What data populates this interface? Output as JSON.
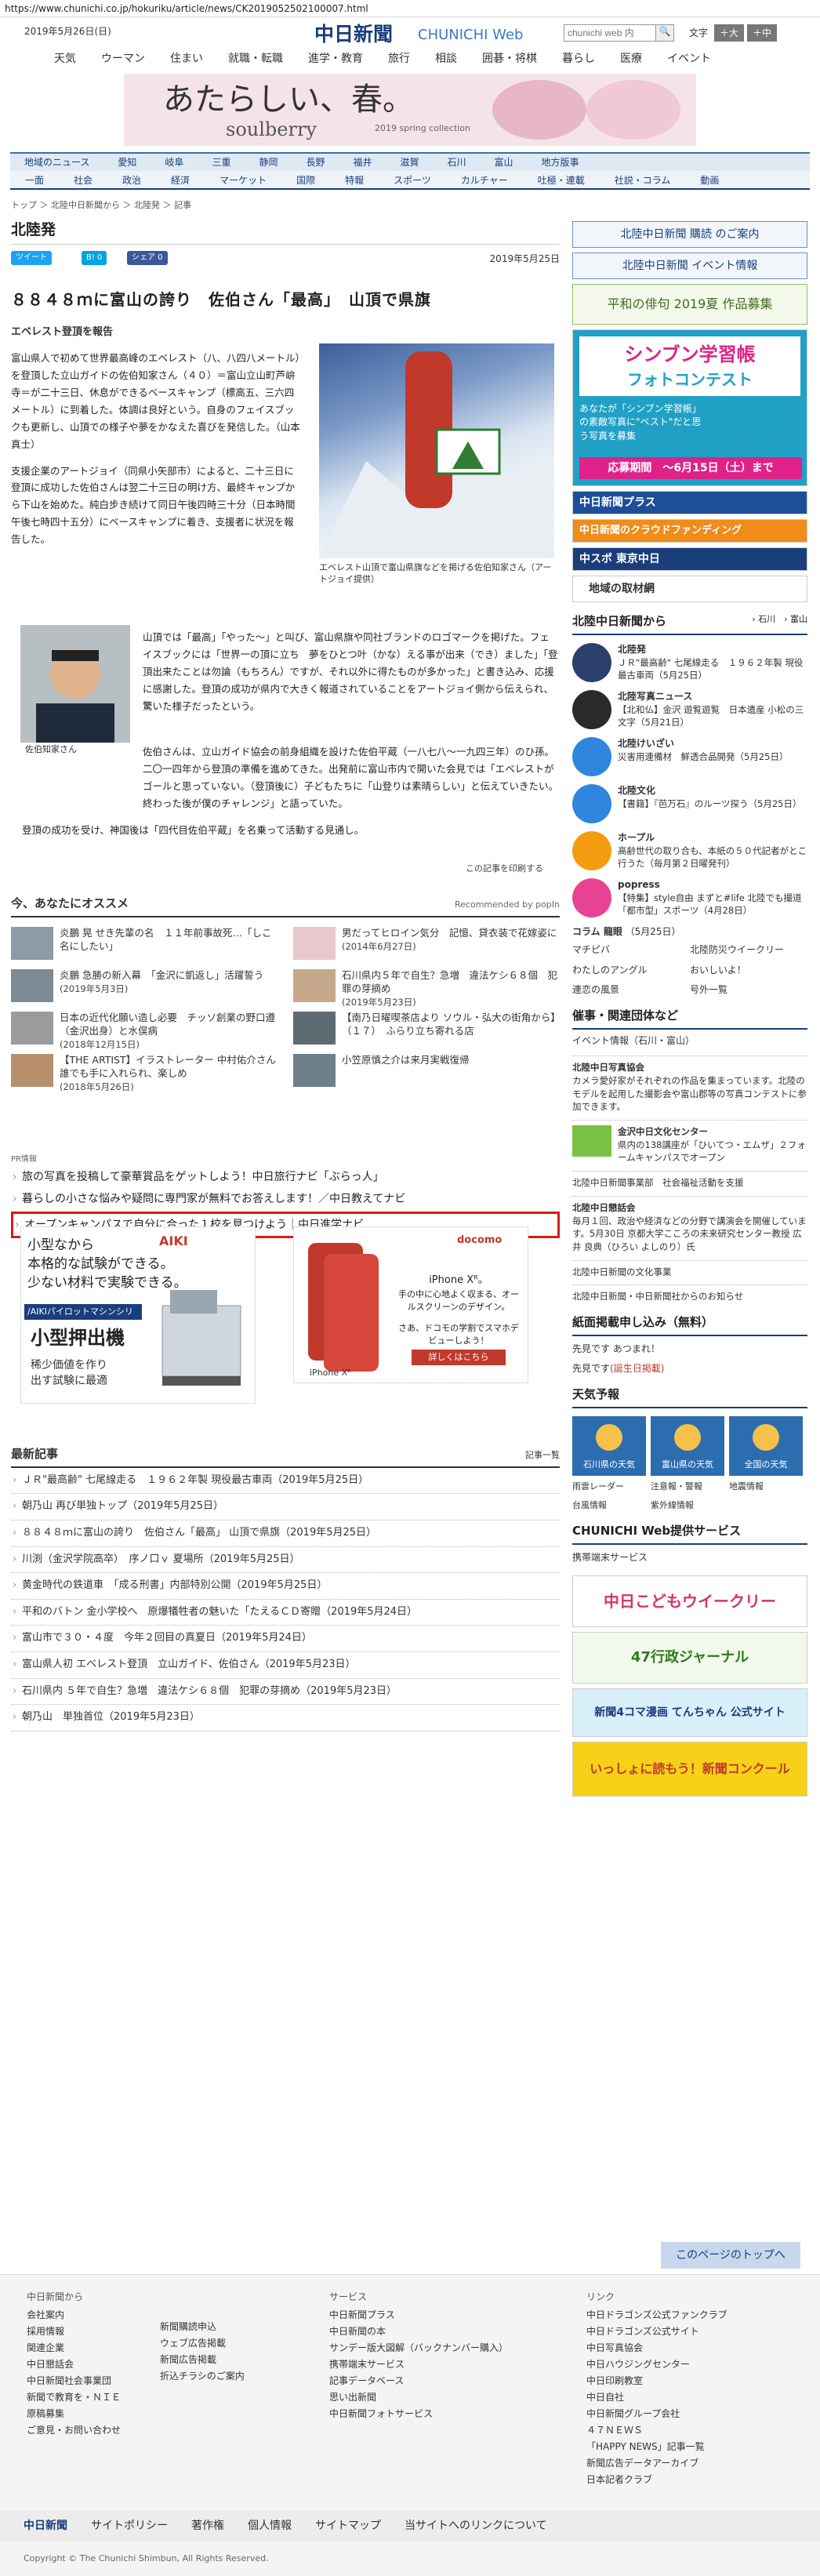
{
  "url": "https://www.chunichi.co.jp/hokuriku/article/news/CK2019052502100007.html",
  "header": {
    "date": "2019年5月26日(日)",
    "logo": "中日新聞",
    "logo_sub": "CHUNICHI Web",
    "search_placeholder": "chunichi web 内",
    "search_button": "🔍",
    "font_label": "文字",
    "font_large": "＋大",
    "font_medium": "＋中"
  },
  "top_nav": [
    "天気",
    "ウーマン",
    "住まい",
    "就職・転職",
    "進学・教育",
    "旅行",
    "相談",
    "囲碁・将棋",
    "暮らし",
    "医療",
    "イベント"
  ],
  "ad_banner": {
    "headline": "あたらしい、春。",
    "brand": "soulberry",
    "sub": "2019 spring collection"
  },
  "region_nav": [
    "地域のニュース",
    "愛知",
    "岐阜",
    "三重",
    "静岡",
    "長野",
    "福井",
    "滋賀",
    "石川",
    "富山",
    "地方版事"
  ],
  "category_nav": [
    "一面",
    "社会",
    "政治",
    "経済",
    "マーケット",
    "国際",
    "特報",
    "スポーツ",
    "カルチャー",
    "吐極・連載",
    "社説・コラム",
    "動画"
  ],
  "breadcrumb": "トップ ＞ 北陸中日新聞から ＞ 北陸発 ＞ 記事",
  "section": "北陸発",
  "share": {
    "tweet": "ツイート",
    "hatena": "B! 0",
    "facebook": "シェア 0"
  },
  "article": {
    "date": "2019年5月25日",
    "title": "８８４８ｍに富山の誇り　佐伯さん「最高」　山頂で県旗",
    "subhead": "エベレスト登頂を報告",
    "p1": "富山県人で初めて世界最高峰のエベレスト（八、八四八メートル）を登頂した立山ガイドの佐伯知家さん（４０）＝富山立山町芦峅寺＝が二十三日、休息ができるベースキャンプ（標高五、三六四メートル）に到着した。体調は良好という。自身のフェイスブックも更新し、山頂での様子や夢をかなえた喜びを発信した。（山本真士）",
    "p2": "支援企業のアートジョイ（同県小矢部市）によると、二十三日に登頂に成功した佐伯さんは翌二十三日の明け方、最終キャンプから下山を始めた。純白步き続けて同日午後四時三十分（日本時間午後七時四十五分）にベースキャンプに着き、支援者に状況を報告した。",
    "p3": "山頂では「最高」「やった～」と叫び、富山県旗や同社ブランドのロゴマークを掲げた。フェイスブックには「世界一の頂に立ち　夢をひとつ叶（かな）える事が出来（でき）ました」「登頂出来たことは勿論（もちろん）ですが、それ以外に得たものが多かった」と書き込み、応援に感謝した。登頂の成功が県内で大きく報道されていることをアートジョイ側から伝えられ、驚いた様子だったという。",
    "p4": "佐伯さんは、立山ガイド協会の前身組織を設けた佐伯平蔵（一八七八～一九四三年）のひ孫。二〇一四年から登頂の準備を進めてきた。出発前に富山市内で開いた会見では「エベレストがゴールと思っていない。（登頂後に）子どもたちに「山登りは素晴らしい」と伝えていきたい。終わった後が僕のチャレンジ」と語っていた。",
    "p5": "登頂の成功を受け、神国後は「四代目佐伯平蔵」を名乗って活動する見通し。",
    "photo_caption": "エベレスト山頂で富山県旗などを掲げる佐伯知家さん（アートジョイ提供）",
    "portrait_caption": "佐伯知家さん",
    "print": "この記事を印刷する"
  },
  "recommend": {
    "heading": "今、あなたにオススメ",
    "powered": "Recommended by popIn",
    "items": [
      {
        "text": "炎鵬 晃 せき先輩の名　１１年前事故死…「しこ名にしたい」",
        "date": ""
      },
      {
        "text": "男だってヒロイン気分　記憶、貸衣装で花嫁姿に",
        "date": "(2014年6月27日)"
      },
      {
        "text": "炎鵬 急勝の新入幕　「金沢に凱返し」活躍誓う",
        "date": "(2019年5月3日)"
      },
      {
        "text": "石川県内５年で自生？急増　違法ケシ６８個　犯罪の芽摘め",
        "date": "(2019年5月23日)"
      },
      {
        "text": "日本の近代化願い造し必要　チッソ創業の野口遵（金沢出身）と水俣病",
        "date": "(2018年12月15日)"
      },
      {
        "text": "【南乃日曜喫茶店より ソウル・弘大の街角から】（１７）　ふらり立ち寄れる店",
        "date": ""
      },
      {
        "text": "【THE ARTIST】イラストレーター 中村佑介さん　誰でも手に入れられ、楽しめ",
        "date": "(2018年5月26日)"
      },
      {
        "text": "小笠原慎之介は来月実戦復帰",
        "date": ""
      }
    ]
  },
  "pr": {
    "label": "PR情報",
    "items": [
      "旅の写真を投稿して豪華賞品をゲットしよう！中日旅行ナビ「ぶらっ人」",
      "暮らしの小さな悩みや疑問に専門家が無料でお答えします！／中日教えてナビ",
      "オープンキャンパスで自分に合った１校を見つけよう｜中日進学ナビ"
    ]
  },
  "ads": {
    "aiki_l1": "小型なから",
    "aiki_l2": "本格的な試験ができる。",
    "aiki_l3": "少ない材料で実験できる。",
    "aiki_brand": "AIKI",
    "aiki_series": "/AIKIパイロットマシンシリーズ",
    "aiki_product": "小型押出機",
    "aiki_note": "稀少価値を作り出す試験に最適",
    "docomo_brand": "docomo",
    "docomo_l1": "iPhone Xᴿ。",
    "docomo_l2": "手の中に心地よく収まる、オールスクリーンのデザイン。",
    "docomo_l3": "さあ、ドコモの学割でスマホデビューしよう！",
    "docomo_btn": "詳しくはこちら",
    "docomo_product": "iPhone Xᴿ"
  },
  "latest": {
    "heading": "最新記事",
    "more": "記事一覧",
    "items": [
      "ＪＲ\"最高齢\" 七尾線走る　１９６２年製 現役最古車両（2019年5月25日）",
      "朝乃山 再び単独トップ（2019年5月25日）",
      "８８４８ｍに富山の誇り　佐伯さん「最高」 山頂で県旗（2019年5月25日）",
      "川渕（金沢学院高卒）　序ノ口ｖ 夏場所（2019年5月25日）",
      "黄金時代の鉄道車　「成る刑書」内部特別公開（2019年5月25日）",
      "平和のバトン 金小学校へ　原爆犠牲者の魅いた「たえるＣＤ寄贈（2019年5月24日）",
      "富山市で３０・４度　今年２回目の真夏日（2019年5月24日）",
      "富山県人初 エベレスト登頂　立山ガイド、佐伯さん（2019年5月23日）",
      "石川県内 ５年で自生？急増　違法ケシ６８個　犯罪の芽摘め（2019年5月23日）",
      "朝乃山　単独首位（2019年5月23日）"
    ]
  },
  "side": {
    "subscribe": "北陸中日新聞 購読 のご案内",
    "event_info": "北陸中日新聞 イベント情報",
    "haiku": "平和の俳句 2019夏 作品募集",
    "shinbun_title": "シンブン学習帳",
    "shinbun_sub": "フォトコンテスト",
    "shinbun_text": "あなたが「シンブン学習帳」の素敵写真に\"ベスト\"だと思う写真を募集",
    "shinbun_deadline": "応募期間　～6月15日（土）まで",
    "plus": "中日新聞プラス",
    "cloud": "中日新聞のクラウドファンディング",
    "chuspo": "中スポ 東京中日",
    "local_info": "地域の取材網",
    "hokuriku_head": "北陸中日新聞から",
    "hokuriku_links": "› 石川　› 富山",
    "items": [
      {
        "title": "北陸発",
        "text": "ＪＲ\"最高齢\" 七尾線走る　１９６２年製 現役最古車両（5月25日）",
        "color": "#2b3f6b"
      },
      {
        "title": "北陸写真ニュース",
        "text": "【北和仏】金沢 遊覧遊覧　日本遺産 小松の三文字（5月21日）",
        "color": "#2b2b2b"
      },
      {
        "title": "北陸けいざい",
        "text": "災害用連備材　鮮透合品開発（5月25日）",
        "color": "#2e86de"
      },
      {
        "title": "北陸文化",
        "text": "【書籍】『芭万石』のルーツ探う（5月25日）",
        "color": "#2e86de"
      },
      {
        "title": "ホープル",
        "text": "高齢世代の取り合も、本紙の５０代記者がとこ行うた（毎月第２日曜発刊）",
        "color": "#f39c12"
      },
      {
        "title": "popress",
        "text": "【特集】style自由 まずと#life 北陸でも撮道「都市型」スポーツ（4月28日）",
        "color": "#e84393"
      }
    ],
    "column": "コラム 龍眼",
    "column_date": "（5月25日）",
    "grid_links": [
      "マチピバ",
      "北陸防災ウイークリー",
      "わたしのアングル",
      "おいしいよ！",
      "連恋の風景",
      "号外一覧"
    ],
    "events_head": "催事・関連団体など",
    "events_sub": "イベント情報（石川・富山）",
    "event1_title": "北陸中日写真協会",
    "event1_text": "カメラ愛好家がそれぞれの作品を集まっています。北陸のモデルを起用した撮影会や富山郡等の写真コンテストに参加できます。",
    "event2_title": "金沢中日文化センター",
    "event2_text": "県内の138講座が「ひいてつ・エムザ」２フォームキャンパスでオープン",
    "event3": "北陸中日新聞事業部　社会福祉活動を支援",
    "event4_title": "北陸中日懇話会",
    "event4_text": "毎月１回、政治や経済などの分野で講演会を開催しています。5月30日 京都大学こころの未来研究センター教授 広井 良典（ひろい よしのり）氏",
    "event5": "北陸中日新聞の文化事業",
    "event6": "北陸中日新聞・中日新聞社からのお知らせ",
    "cup_head": "紙面掲載申し込み（無料）",
    "cup1": "先見です あつまれ！",
    "cup2": "先見です",
    "cup2_link": "(誕生日掲載)",
    "weather_head": "天気予報",
    "weather": [
      "石川県の天気",
      "富山県の天気",
      "全国の天気"
    ],
    "weather_links": [
      "雨雲レーダー",
      "注意報・警報",
      "地震情報",
      "台風情報",
      "紫外線情報"
    ],
    "web_head": "CHUNICHI Web提供サービス",
    "web_link": "携帯端末サービス",
    "kodomo": "中日こどもウイークリー",
    "gyosei": "47行政ジャーナル",
    "tenchan": "新聞4コマ漫画 てんちゃん 公式サイト",
    "nie": "いっしょに読もう！新聞コンクール"
  },
  "footer": {
    "to_top": "このページのトップへ",
    "col1_head": "中日新聞から",
    "col1": [
      "会社案内",
      "採用情報",
      "関連企業",
      "中日懇話会",
      "中日新聞社会事業団",
      "新聞で教育を・ＮＩＥ",
      "原稿募集",
      "ご意見・お問い合わせ"
    ],
    "col2": [
      "新聞購読申込",
      "ウェブ広告掲載",
      "新聞広告掲載",
      "折込チラシのご案内"
    ],
    "col3_head": "サービス",
    "col3": [
      "中日新聞プラス",
      "中日新聞の本",
      "サンデー版大図解（バックナンバー購入）",
      "携帯端末サービス",
      "記事データベース",
      "思い出新聞",
      "中日新聞フォトサービス"
    ],
    "col4_head": "リンク",
    "col4": [
      "中日ドラゴンズ公式ファンクラブ",
      "中日ドラゴンズ公式サイト",
      "中日写真協会",
      "中日ハウジングセンター",
      "中日印刷教室",
      "中日自社",
      "中日新聞グループ会社",
      "４７ＮＥＷＳ",
      "「HAPPY NEWS」記事一覧",
      "新聞広告データアーカイブ",
      "日本記者クラブ"
    ],
    "bar": [
      "中日新聞",
      "サイトポリシー",
      "著作権",
      "個人情報",
      "サイトマップ",
      "当サイトへのリンクについて"
    ],
    "copyright": "Copyright © The Chunichi Shimbun, All Rights Reserved."
  }
}
